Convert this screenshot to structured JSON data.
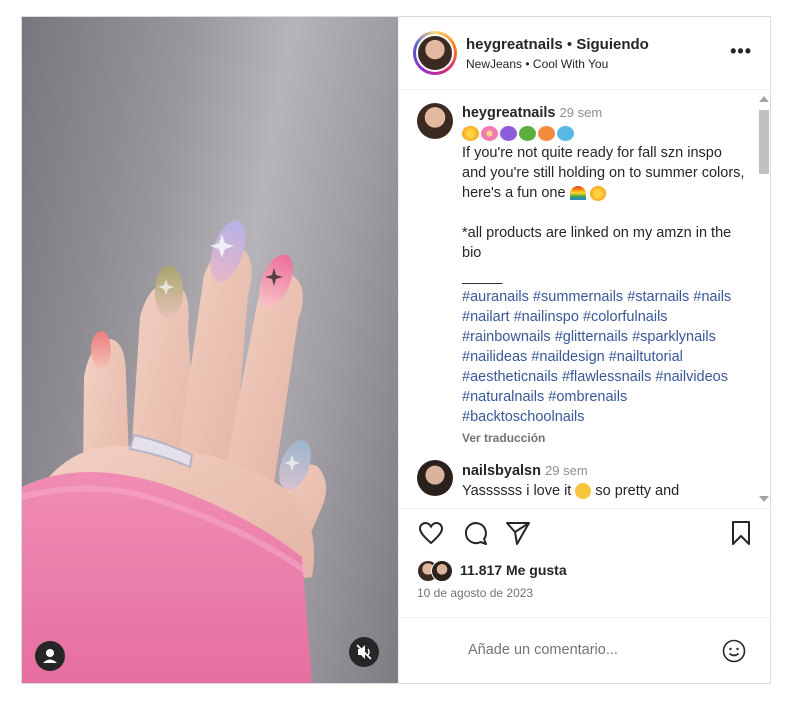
{
  "header": {
    "username": "heygreatnails",
    "separator": "•",
    "follow_label": "Siguiendo",
    "music": "NewJeans • Cool With You",
    "more_icon": "more-horizontal-icon"
  },
  "caption": {
    "username": "heygreatnails",
    "time": "29 sem",
    "line1": "If you're not quite ready for fall szn inspo and you're still holding on to summer colors, here's a fun one",
    "line2": "*all products are linked on my amzn in the bio",
    "divider": "_____",
    "hashtags": "#auranails #summernails #starnails #nails #nailart #nailinspo #colorfulnails #rainbownails #glitternails #sparklynails #nailideas #naildesign #nailtutorial #aestheticnails #flawlessnails #nailvideos #naturalnails #ombrenails #backtoschoolnails",
    "translate": "Ver traducción"
  },
  "comment": {
    "username": "nailsbyalsn",
    "time": "29 sem",
    "text": "Yassssss i love it",
    "text2": "so pretty and"
  },
  "actions": {
    "like_icon": "heart-icon",
    "comment_icon": "comment-icon",
    "share_icon": "send-icon",
    "save_icon": "bookmark-icon"
  },
  "likes": {
    "count": "11.817 Me gusta"
  },
  "date": "10 de agosto de 2023",
  "add_comment": {
    "placeholder": "Añade un comentario..."
  },
  "colors": {
    "link": "#385898",
    "muted": "#737373",
    "text": "#262626"
  }
}
